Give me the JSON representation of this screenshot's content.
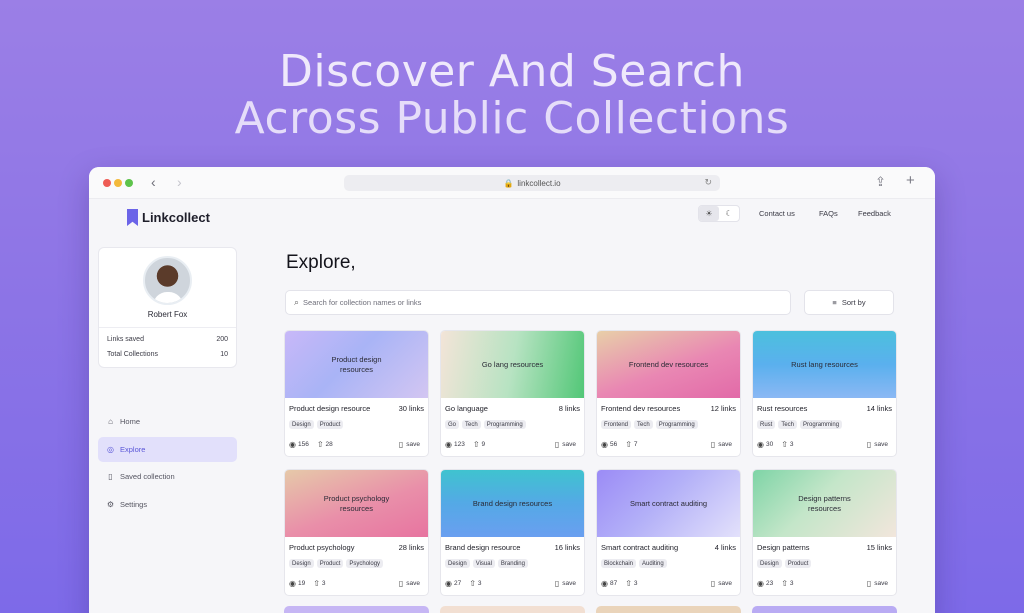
{
  "hero": {
    "line1": "Discover And Search",
    "line2": "Across Public Collections"
  },
  "browser": {
    "url": "linkcollect.io"
  },
  "app": {
    "logo_text": "Linkcollect"
  },
  "profile": {
    "name": "Robert Fox",
    "links_saved_label": "Links saved",
    "links_saved_value": "200",
    "total_collections_label": "Total Collections",
    "total_collections_value": "10"
  },
  "nav": {
    "items": [
      {
        "label": "Home",
        "icon": "home-icon"
      },
      {
        "label": "Explore",
        "icon": "explore-icon"
      },
      {
        "label": "Saved collection",
        "icon": "bookmark-icon"
      },
      {
        "label": "Settings",
        "icon": "gear-icon"
      }
    ],
    "active": "Explore"
  },
  "topbar": {
    "contact": "Contact us",
    "faqs": "FAQs",
    "feedback": "Feedback"
  },
  "main": {
    "title": "Explore,",
    "search_placeholder": "Search for collection names or links",
    "sort_label": "Sort by"
  },
  "collections": [
    {
      "thumb_title": "Product design resources",
      "name": "Product design resource",
      "links": "30 links",
      "tags": [
        "Design",
        "Product"
      ],
      "views": "156",
      "upvotes": "28",
      "save": "save",
      "gradient": "linear-gradient(135deg,#c8b8f8 0%,#a9b4f6 45%,#d3c6f2 100%)"
    },
    {
      "thumb_title": "Go lang resources",
      "name": "Go language",
      "links": "8 links",
      "tags": [
        "Go",
        "Tech",
        "Programming"
      ],
      "views": "123",
      "upvotes": "9",
      "save": "save",
      "gradient": "linear-gradient(100deg,#f3e4d8 0%,#b7e3c2 50%,#52c777 100%)"
    },
    {
      "thumb_title": "Frontend dev resources",
      "name": "Frontend dev resources",
      "links": "12 links",
      "tags": [
        "Frontend",
        "Tech",
        "Programming"
      ],
      "views": "56",
      "upvotes": "7",
      "save": "save",
      "gradient": "linear-gradient(160deg,#e8cfa8 0%,#e987b3 55%,#e26aa8 100%)"
    },
    {
      "thumb_title": "Rust lang resources",
      "name": "Rust resources",
      "links": "14 links",
      "tags": [
        "Rust",
        "Tech",
        "Programming"
      ],
      "views": "30",
      "upvotes": "3",
      "save": "save",
      "gradient": "linear-gradient(180deg,#4cc0dd 0%,#5ab0ee 50%,#8bb8f4 100%)"
    },
    {
      "thumb_title": "Product psychology resources",
      "name": "Product psychology",
      "links": "28 links",
      "tags": [
        "Design",
        "Product",
        "Psychology"
      ],
      "views": "19",
      "upvotes": "3",
      "save": "save",
      "gradient": "linear-gradient(160deg,#e6c9a9 0%,#e98fa9 55%,#e774a0 100%)"
    },
    {
      "thumb_title": "Brand design resources",
      "name": "Brand design resource",
      "links": "16 links",
      "tags": [
        "Design",
        "Visual",
        "Branding"
      ],
      "views": "27",
      "upvotes": "3",
      "save": "save",
      "gradient": "linear-gradient(180deg,#3fc3cf 0%,#54a9e6 50%,#6a9ff0 100%)"
    },
    {
      "thumb_title": "Smart contract auditing",
      "name": "Smart contract auditing",
      "links": "4 links",
      "tags": [
        "Blockchain",
        "Auditing"
      ],
      "views": "87",
      "upvotes": "3",
      "save": "save",
      "gradient": "linear-gradient(135deg,#9b8bf6 0%,#b3b0f8 45%,#e3e1fb 100%)"
    },
    {
      "thumb_title": "Design patterns resources",
      "name": "Design patterns",
      "links": "15 links",
      "tags": [
        "Design",
        "Product"
      ],
      "views": "23",
      "upvotes": "3",
      "save": "save",
      "gradient": "linear-gradient(135deg,#7ed4a6 0%,#c4e6c9 45%,#f2e6dc 100%)"
    }
  ],
  "peek_gradients": [
    "#c6b6f4",
    "#f2dfd2",
    "#ead4ba",
    "#b9abf3"
  ]
}
